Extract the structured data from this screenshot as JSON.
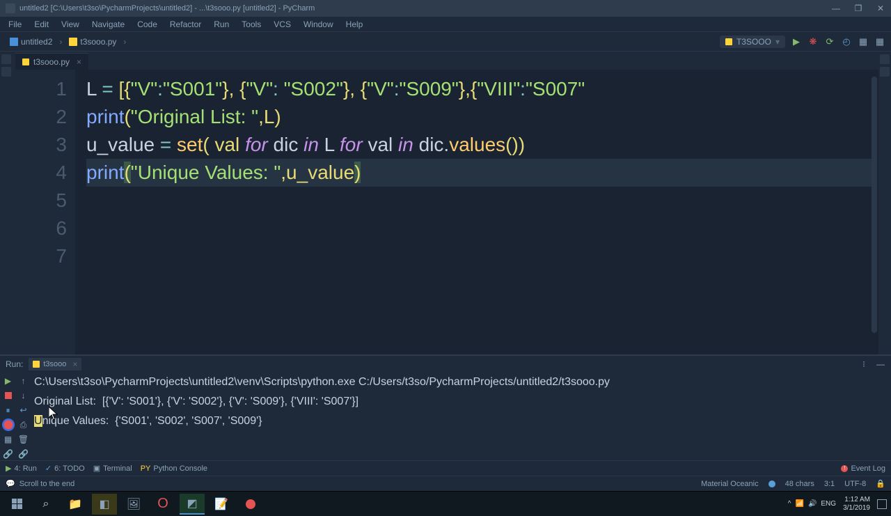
{
  "titlebar": {
    "title": "untitled2 [C:\\Users\\t3so\\PycharmProjects\\untitled2] - ...\\t3sooo.py [untitled2] - PyCharm"
  },
  "menus": [
    "File",
    "Edit",
    "View",
    "Navigate",
    "Code",
    "Refactor",
    "Run",
    "Tools",
    "VCS",
    "Window",
    "Help"
  ],
  "breadcrumb": {
    "project": "untitled2",
    "file": "t3sooo.py"
  },
  "runConfig": {
    "name": "T3SOOO"
  },
  "tab": {
    "name": "t3sooo.py"
  },
  "lineNumbers": [
    "1",
    "2",
    "3",
    "4",
    "5",
    "6",
    "7"
  ],
  "code": {
    "line1": {
      "p1": "L ",
      "op1": "= ",
      "br1": "[{",
      "s1": "\"V\"",
      "col1": ":",
      "s2": "\"S001\"",
      "br2": "}, {",
      "s3": "\"V\"",
      "col2": ": ",
      "s4": "\"S002\"",
      "br3": "}, {",
      "s5": "\"V\"",
      "col3": ":",
      "s6": "\"S009\"",
      "br4": "},{",
      "s7": "\"VIII\"",
      "col4": ":",
      "s8": "\"S007\""
    },
    "line2": {
      "fn": "print",
      "p1": "(",
      "s1": "\"Original List: \"",
      "c1": ",L)"
    },
    "line3": {
      "v1": "u_value ",
      "op": "= ",
      "fn": "set",
      "p1": "( val ",
      "kw1": "for",
      "p2": " dic ",
      "kw2": "in",
      "p3": " L ",
      "kw3": "for",
      "p4": " val ",
      "kw4": "in",
      "p5": " dic.",
      "fn2": "values",
      "p6": "())"
    },
    "line4": {
      "fn": "print",
      "p1": "(",
      "s1": "\"Unique Values: \"",
      "c1": ",u_value",
      "p2": ")"
    }
  },
  "runPanel": {
    "label": "Run:",
    "tabName": "t3sooo",
    "output": {
      "line1": "C:\\Users\\t3so\\PycharmProjects\\untitled2\\venv\\Scripts\\python.exe C:/Users/t3so/PycharmProjects/untitled2/t3sooo.py",
      "line2": "Original List:  [{'V': 'S001'}, {'V': 'S002'}, {'V': 'S009'}, {'VIII': 'S007'}]",
      "line3_hl": "U",
      "line3_rest": "nique Values:  {'S001', 'S002', 'S007', 'S009'}"
    }
  },
  "bottomTabs": {
    "run": "4: Run",
    "todo": "6: TODO",
    "terminal": "Terminal",
    "pyconsole": "Python Console",
    "eventLog": "Event Log"
  },
  "statusbar": {
    "scroll": "Scroll to the end",
    "theme": "Material Oceanic",
    "chars": "48 chars",
    "pos": "3:1",
    "encoding": "UTF-8",
    "lock": ""
  },
  "taskbar": {
    "tray": {
      "up": "^",
      "wifi": "",
      "vol": "",
      "lang": "ENG"
    },
    "clock": {
      "time": "1:12 AM",
      "date": "3/1/2019"
    }
  }
}
